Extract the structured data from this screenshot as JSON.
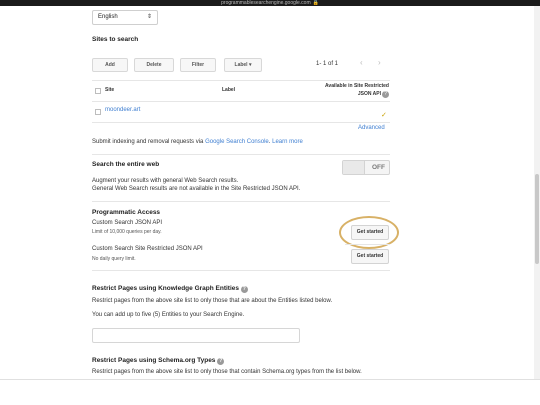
{
  "browser": {
    "url": "programmablesearchengine.google.com"
  },
  "language_select": {
    "value": "English"
  },
  "sites": {
    "title": "Sites to search",
    "buttons": {
      "add": "Add",
      "delete": "Delete",
      "filter": "Filter",
      "label": "Label"
    },
    "pagination": "1- 1 of 1",
    "columns": {
      "site": "Site",
      "label": "Label",
      "restricted_line1": "Available in Site Restricted",
      "restricted_line2": "JSON API"
    },
    "rows": [
      {
        "site": "moondeer.art",
        "label": "",
        "restricted": "✓"
      }
    ],
    "advanced": "Advanced",
    "indexing_prefix": "Submit indexing and removal requests via ",
    "indexing_link1": "Google Search Console",
    "indexing_link2": "Learn more"
  },
  "search_web": {
    "title": "Search the entire web",
    "toggle": "OFF",
    "desc1": "Augment your results with general Web Search results.",
    "desc2": "General Web Search results are not available in the Site Restricted JSON API."
  },
  "programmatic": {
    "title": "Programmatic Access",
    "items": [
      {
        "name": "Custom Search JSON API",
        "note": "Limit of 10,000 queries per day.",
        "button": "Get started"
      },
      {
        "name": "Custom Search Site Restricted JSON API",
        "note": "No daily query limit.",
        "button": "Get started"
      }
    ]
  },
  "knowledge_graph": {
    "title": "Restrict Pages using Knowledge Graph Entities",
    "desc": "Restrict pages from the above site list to only those that are about the Entities listed below.",
    "note": "You can add up to five (5) Entities to your Search Engine."
  },
  "schema": {
    "title": "Restrict Pages using Schema.org Types",
    "desc": "Restrict pages from the above site list to only those that contain Schema.org types from the list below."
  },
  "colors": {
    "link": "#3f7fd1",
    "highlight": "#d8b166",
    "check": "#c9a100"
  }
}
